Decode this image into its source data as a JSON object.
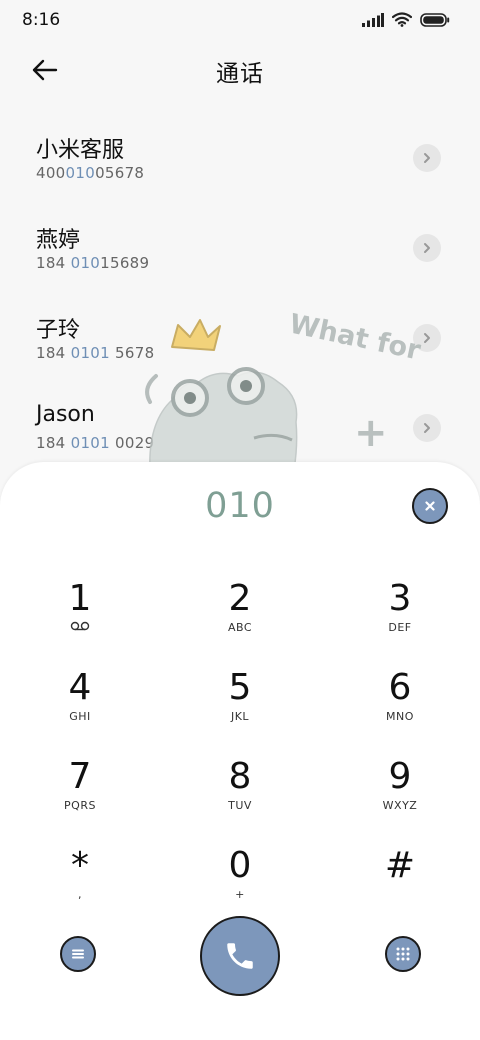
{
  "status_bar": {
    "time": "8:16"
  },
  "header": {
    "title": "通话"
  },
  "contacts": [
    {
      "name": "小米客服",
      "number_pre": "400",
      "number_hl": "010",
      "number_post": "05678"
    },
    {
      "name": "燕婷",
      "number_pre": "184 ",
      "number_hl": "010",
      "number_post": "15689"
    },
    {
      "name": "子玲",
      "number_pre": "184 ",
      "number_hl": "0101",
      "number_post": " 5678"
    },
    {
      "name": "Jason",
      "number_pre": "184 ",
      "number_hl": "0101",
      "number_post": " 0029"
    }
  ],
  "wallpaper": {
    "text": "What for",
    "plus": "+"
  },
  "dialpad": {
    "display": "010",
    "keys": [
      {
        "digit": "1",
        "sub": ""
      },
      {
        "digit": "2",
        "sub": "ABC"
      },
      {
        "digit": "3",
        "sub": "DEF"
      },
      {
        "digit": "4",
        "sub": "GHI"
      },
      {
        "digit": "5",
        "sub": "JKL"
      },
      {
        "digit": "6",
        "sub": "MNO"
      },
      {
        "digit": "7",
        "sub": "PQRS"
      },
      {
        "digit": "8",
        "sub": "TUV"
      },
      {
        "digit": "9",
        "sub": "WXYZ"
      },
      {
        "digit": "*",
        "sub": ","
      },
      {
        "digit": "0",
        "sub": "+"
      },
      {
        "digit": "#",
        "sub": ""
      }
    ]
  },
  "colors": {
    "accent": "#7d97bb",
    "display_text": "#7f9f94",
    "number_highlight": "#6f8fb5"
  },
  "icons": {
    "signal": "signal-icon",
    "wifi": "wifi-icon",
    "battery": "battery-icon",
    "back": "back-arrow-icon",
    "detail": "chevron-right-icon",
    "clear": "clear-icon",
    "voicemail": "voicemail-icon",
    "menu": "menu-icon",
    "call": "phone-icon",
    "keypad": "keypad-icon"
  }
}
